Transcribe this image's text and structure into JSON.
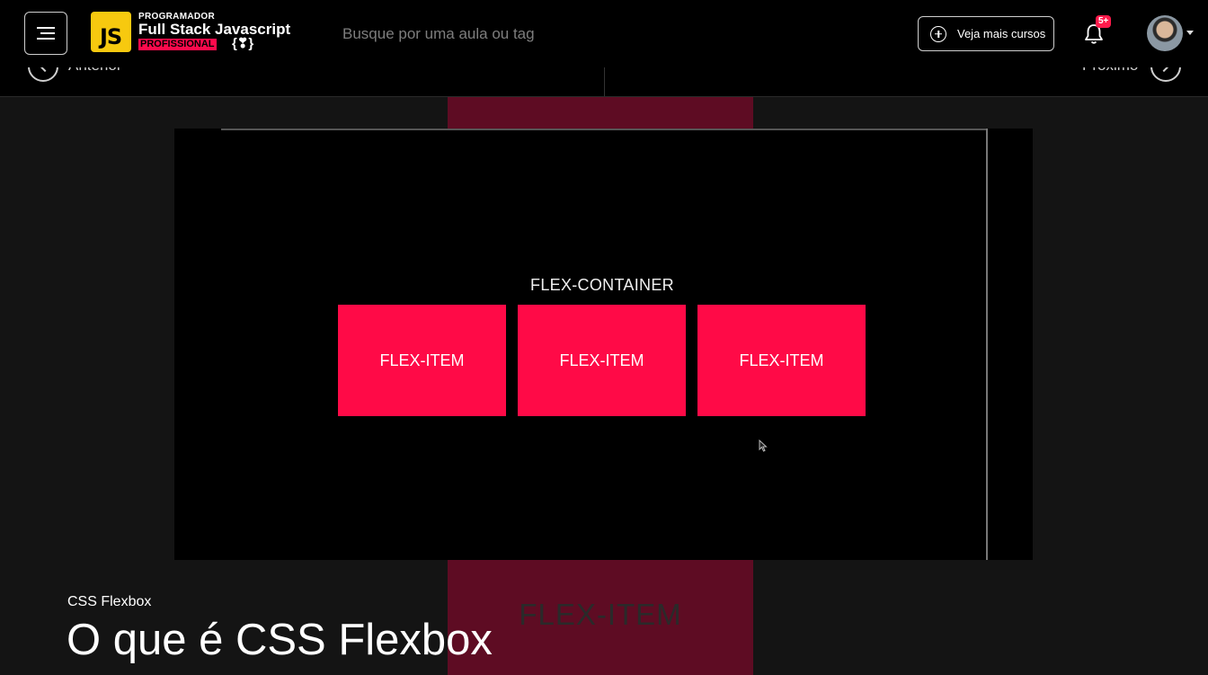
{
  "header": {
    "menu_icon": "hamburger-icon",
    "logo": {
      "badge": "JS",
      "line1": "PROGRAMADOR",
      "line2": "Full Stack Javascript",
      "line3": "PROFISSIONAL",
      "brace": "{❣}"
    },
    "search_placeholder": "Busque por uma aula ou tag",
    "courses_button_label": "Veja mais cursos",
    "notification_count": "5+",
    "accent_color": "#ff1a4b"
  },
  "nav": {
    "prev_label": "Anterior",
    "next_label": "Próximo"
  },
  "video": {
    "container_label": "FLEX-CONTAINER",
    "items": [
      "FLEX-ITEM",
      "FLEX-ITEM",
      "FLEX-ITEM"
    ],
    "background_item_label": "FLEX-ITEM",
    "item_color": "#ff0a47"
  },
  "lesson": {
    "section": "CSS Flexbox",
    "title": "O que é CSS Flexbox"
  }
}
